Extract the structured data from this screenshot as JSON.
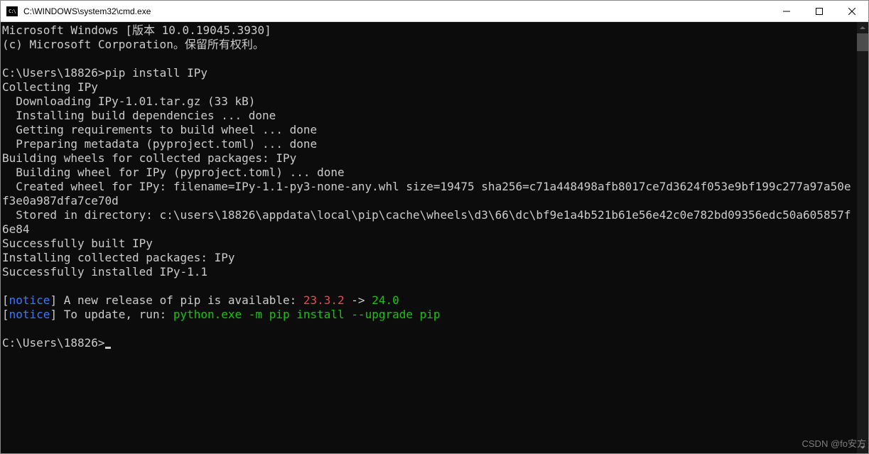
{
  "window": {
    "title": "C:\\WINDOWS\\system32\\cmd.exe"
  },
  "terminal": {
    "header_line1": "Microsoft Windows [版本 10.0.19045.3930]",
    "header_line2": "(c) Microsoft Corporation。保留所有权利。",
    "prompt1_path": "C:\\Users\\18826>",
    "prompt1_cmd": "pip install IPy",
    "out": {
      "l1": "Collecting IPy",
      "l2": "  Downloading IPy-1.01.tar.gz (33 kB)",
      "l3": "  Installing build dependencies ... done",
      "l4": "  Getting requirements to build wheel ... done",
      "l5": "  Preparing metadata (pyproject.toml) ... done",
      "l6": "Building wheels for collected packages: IPy",
      "l7": "  Building wheel for IPy (pyproject.toml) ... done",
      "l8": "  Created wheel for IPy: filename=IPy-1.1-py3-none-any.whl size=19475 sha256=c71a448498afb8017ce7d3624f053e9bf199c277a97a50ef3e0a987dfa7ce70d",
      "l9": "  Stored in directory: c:\\users\\18826\\appdata\\local\\pip\\cache\\wheels\\d3\\66\\dc\\bf9e1a4b521b61e56e42c0e782bd09356edc50a605857f6e84",
      "l10": "Successfully built IPy",
      "l11": "Installing collected packages: IPy",
      "l12": "Successfully installed IPy-1.1"
    },
    "notice1": {
      "bracket_l": "[",
      "notice": "notice",
      "bracket_r": "]",
      "text_a": " A new release of pip is available: ",
      "old_ver": "23.3.2",
      "arrow": " -> ",
      "new_ver": "24.0"
    },
    "notice2": {
      "bracket_l": "[",
      "notice": "notice",
      "bracket_r": "]",
      "text_a": " To update, run: ",
      "cmd": "python.exe -m pip install --upgrade pip"
    },
    "prompt2_path": "C:\\Users\\18826>"
  },
  "watermark": "CSDN @fo安方"
}
